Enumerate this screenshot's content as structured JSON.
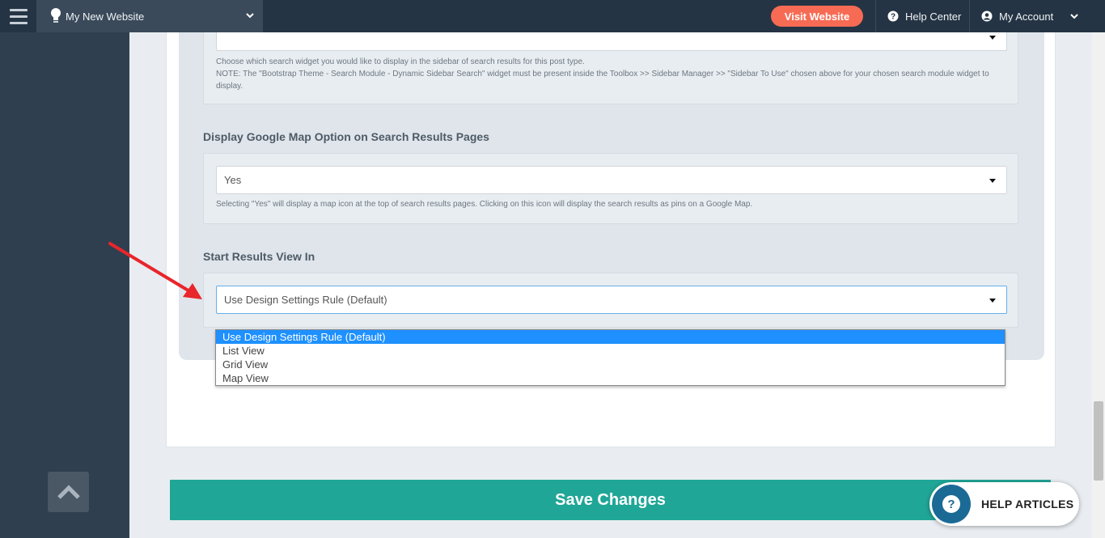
{
  "topbar": {
    "site_name": "My New Website",
    "visit_label": "Visit Website",
    "help_center_label": "Help Center",
    "account_label": "My Account"
  },
  "fields": {
    "search_widget": {
      "value": "",
      "help_line1": "Choose which search widget you would like to display in the sidebar of search results for this post type.",
      "help_line2": "NOTE: The \"Bootstrap Theme - Search Module - Dynamic Sidebar Search\" widget must be present inside the Toolbox >> Sidebar Manager >> \"Sidebar To Use\" chosen above for your chosen search module widget to display."
    },
    "google_map": {
      "label": "Display Google Map Option on Search Results Pages",
      "value": "Yes",
      "help": "Selecting \"Yes\" will display a map icon at the top of search results pages. Clicking on this icon will display the search results as pins on a Google Map."
    },
    "results_view": {
      "label": "Start Results View In",
      "value": "Use Design Settings Rule (Default)",
      "options": [
        "Use Design Settings Rule (Default)",
        "List View",
        "Grid View",
        "Map View"
      ]
    }
  },
  "save_label": "Save Changes",
  "help_articles_label": "HELP ARTICLES",
  "colors": {
    "topbar": "#253444",
    "sidebar": "#2f3f4f",
    "visit_button": "#f76b54",
    "save_button": "#20a697",
    "selected_option": "#1e90ff",
    "annotation_arrow": "#e8262b"
  },
  "icons": [
    "hamburger-icon",
    "lightbulb-icon",
    "chevron-down-icon",
    "question-circle-icon",
    "user-circle-icon",
    "chevron-up-icon",
    "caret-down-icon"
  ]
}
